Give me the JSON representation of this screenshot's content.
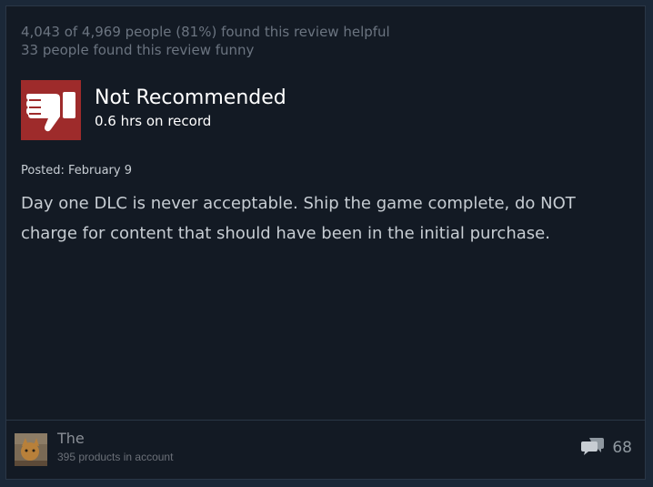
{
  "review": {
    "helpful_text": "4,043 of 4,969 people (81%) found this review helpful",
    "funny_text": "33 people found this review funny",
    "verdict": {
      "title": "Not Recommended",
      "hours": "0.6 hrs on record",
      "icon": "thumbs-down-icon",
      "icon_bg_color": "#9e2b2b"
    },
    "posted": "Posted: February 9",
    "body": "Day one DLC is never acceptable. Ship the game complete, do NOT charge for content that should have been in the initial purchase."
  },
  "author": {
    "name": "The",
    "products": "395 products in account",
    "avatar": "user-avatar"
  },
  "comments": {
    "icon": "comment-bubbles-icon",
    "count": "68"
  },
  "colors": {
    "page_bg": "#1b2838",
    "card_bg": "#131a24",
    "text_muted": "#6b7480",
    "text_body": "#c7cdd3"
  }
}
